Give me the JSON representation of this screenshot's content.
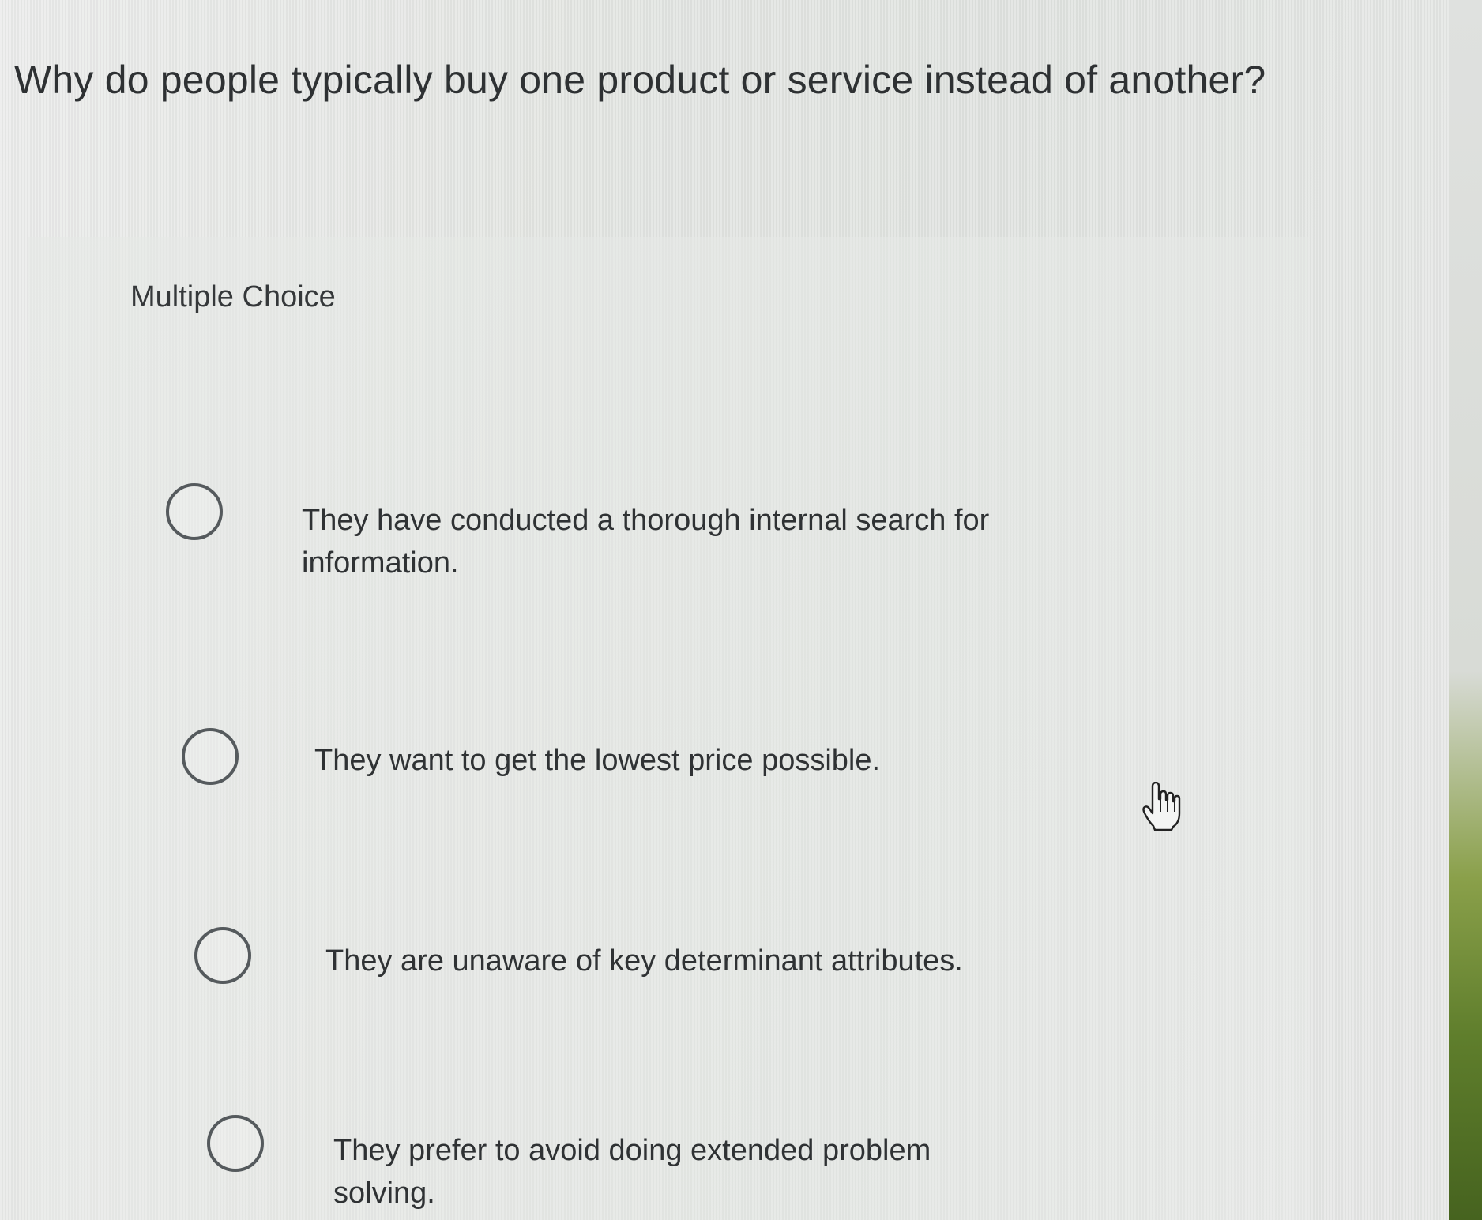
{
  "question": {
    "text": "Why do people typically buy one product or service instead of another?"
  },
  "question_type": "Multiple Choice",
  "choices": [
    {
      "label": "They have conducted a thorough internal search for information."
    },
    {
      "label": "They want to get the lowest price possible."
    },
    {
      "label": "They are unaware of key determinant attributes."
    },
    {
      "label": "They prefer to avoid doing extended problem solving."
    }
  ],
  "cursor": {
    "icon": "hand-pointer-icon"
  }
}
